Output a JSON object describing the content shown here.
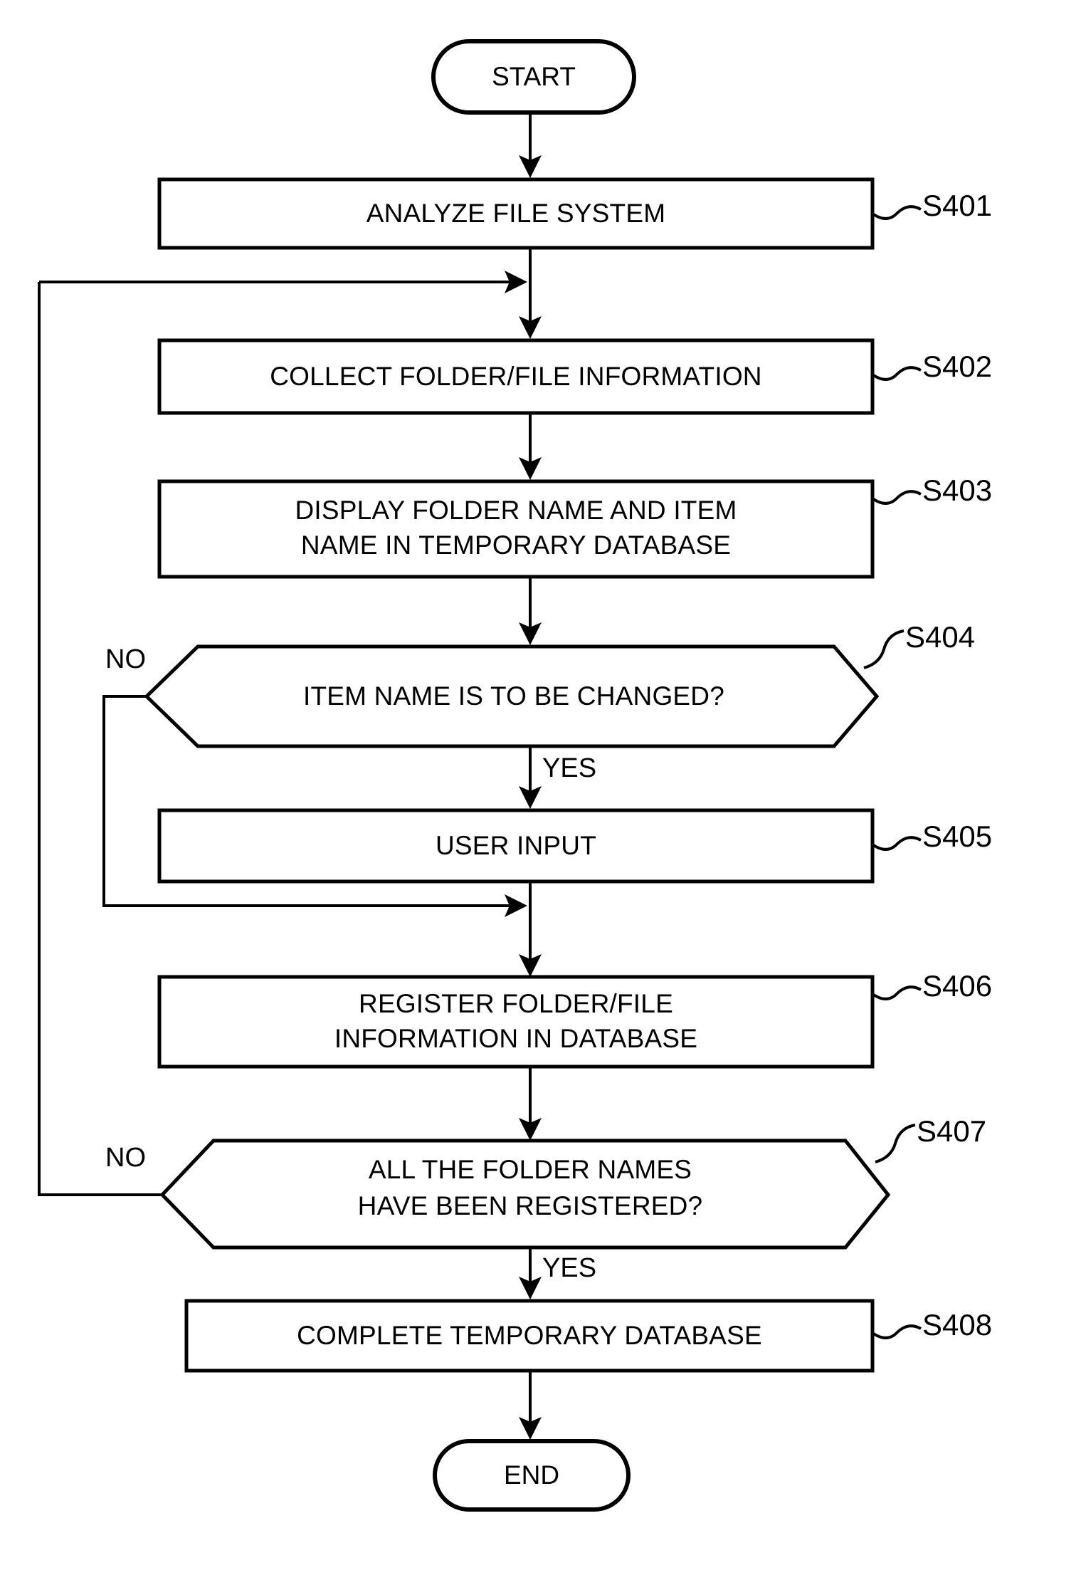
{
  "diagram": {
    "title": "Flowchart for temporary database registration process",
    "background_color": "#ffffff",
    "line_color": "#000000"
  },
  "terminators": {
    "start": "START",
    "end": "END"
  },
  "nodes": [
    {
      "id": "S401",
      "label": "S401",
      "type": "process",
      "lines": [
        "ANALYZE FILE SYSTEM"
      ]
    },
    {
      "id": "S402",
      "label": "S402",
      "type": "process",
      "lines": [
        "COLLECT FOLDER/FILE INFORMATION"
      ]
    },
    {
      "id": "S403",
      "label": "S403",
      "type": "process",
      "lines": [
        "DISPLAY FOLDER NAME AND ITEM",
        "NAME IN TEMPORARY DATABASE"
      ]
    },
    {
      "id": "S404",
      "label": "S404",
      "type": "decision",
      "lines": [
        "ITEM NAME IS TO BE CHANGED?"
      ]
    },
    {
      "id": "S405",
      "label": "S405",
      "type": "process",
      "lines": [
        "USER INPUT"
      ]
    },
    {
      "id": "S406",
      "label": "S406",
      "type": "process",
      "lines": [
        "REGISTER FOLDER/FILE",
        "INFORMATION IN DATABASE"
      ]
    },
    {
      "id": "S407",
      "label": "S407",
      "type": "decision",
      "lines": [
        "ALL THE FOLDER NAMES",
        "HAVE BEEN REGISTERED?"
      ]
    },
    {
      "id": "S408",
      "label": "S408",
      "type": "process",
      "lines": [
        "COMPLETE TEMPORARY DATABASE"
      ]
    }
  ],
  "branch_labels": {
    "s404_no": "NO",
    "s404_yes": "YES",
    "s407_no": "NO",
    "s407_yes": "YES"
  }
}
